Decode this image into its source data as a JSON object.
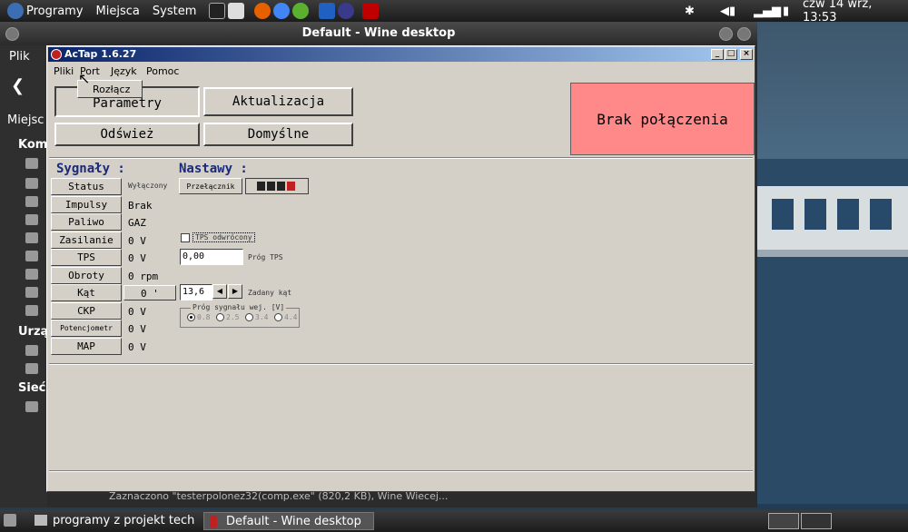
{
  "top_panel": {
    "menus": [
      "Programy",
      "Miejsca",
      "System"
    ],
    "clock": "czw 14 wrz, 13:53"
  },
  "outer_window": {
    "title": "Default - Wine desktop"
  },
  "nautilus": {
    "items": [
      "Plik",
      "Miejsc",
      "Kom",
      "Urzą",
      "Sieć"
    ]
  },
  "app": {
    "title": "AcTap 1.6.27",
    "menu": [
      "Pliki",
      "Port",
      "Język",
      "Pomoc"
    ],
    "dropdown_item": "Rozłącz",
    "buttons": {
      "parametry": "Parametry",
      "aktualizacja": "Aktualizacja",
      "odswiez": "Odśwież",
      "domyslne": "Domyślne"
    },
    "connection_status": "Brak połączenia",
    "headers": {
      "signals": "Sygnały :",
      "settings": "Nastawy :"
    },
    "signals": [
      {
        "label": "Status",
        "value": "Wyłączony"
      },
      {
        "label": "Impulsy",
        "value": "Brak"
      },
      {
        "label": "Paliwo",
        "value": "GAZ"
      },
      {
        "label": "Zasilanie",
        "value": "0 V"
      },
      {
        "label": "TPS",
        "value": "0 V"
      },
      {
        "label": "Obroty",
        "value": "0 rpm"
      },
      {
        "label": "Kąt",
        "value": "0 '"
      },
      {
        "label": "CKP",
        "value": "0 V"
      },
      {
        "label": "Potencjometr",
        "value": "0 V"
      },
      {
        "label": "MAP",
        "value": "0 V"
      }
    ],
    "settings": {
      "switch_label": "Przełącznik",
      "tps_inverted_label": "TPS odwrócony",
      "tps_threshold_value": "0,00",
      "tps_threshold_label": "Próg TPS",
      "angle_value": "13,6",
      "angle_label": "Zadany kąt",
      "threshold_group_label": "Próg sygnału wej. [V]",
      "threshold_options": [
        "0.8",
        "2.5",
        "3.4",
        "4.4"
      ]
    }
  },
  "bottom_panel": {
    "tasks": [
      "programy z projekt tech",
      "Default - Wine desktop"
    ],
    "behind_text": "Zaznaczono \"testerpolonez32(comp.exe\" (820,2 KB), Wine Wiecej..."
  },
  "colors": {
    "status_bg": "#ff8888",
    "header_blue": "#1a2a7a"
  }
}
